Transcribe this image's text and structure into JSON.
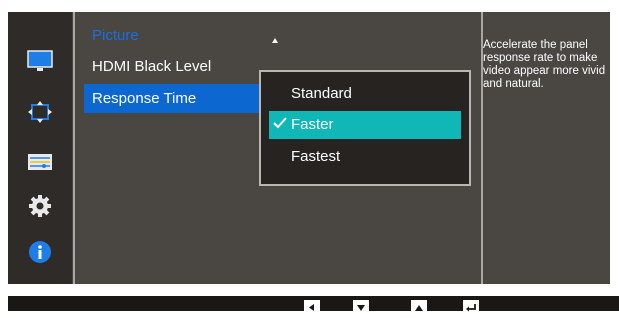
{
  "nav": {
    "items": [
      {
        "name": "picture",
        "icon": "monitor-icon"
      },
      {
        "name": "onscreen-display",
        "icon": "resize-arrows-icon"
      },
      {
        "name": "system",
        "icon": "sliders-icon"
      },
      {
        "name": "settings",
        "icon": "gear-icon"
      },
      {
        "name": "information",
        "icon": "info-icon"
      }
    ]
  },
  "menu": {
    "title": "Picture",
    "items": [
      {
        "label": "HDMI Black Level",
        "selected": false
      },
      {
        "label": "Response Time",
        "selected": true
      }
    ]
  },
  "submenu": {
    "options": [
      "Standard",
      "Faster",
      "Fastest"
    ],
    "checked": "Faster"
  },
  "description": {
    "text": "Accelerate the panel response rate to make video appear more vivid and natural."
  },
  "keys": [
    "left-key",
    "down-key",
    "up-key",
    "enter-key"
  ],
  "colors": {
    "frame": "#4a4642",
    "selected_blue": "#0c67d0",
    "checked_teal": "#0fb7b6",
    "title_blue": "#1b6fe0"
  }
}
